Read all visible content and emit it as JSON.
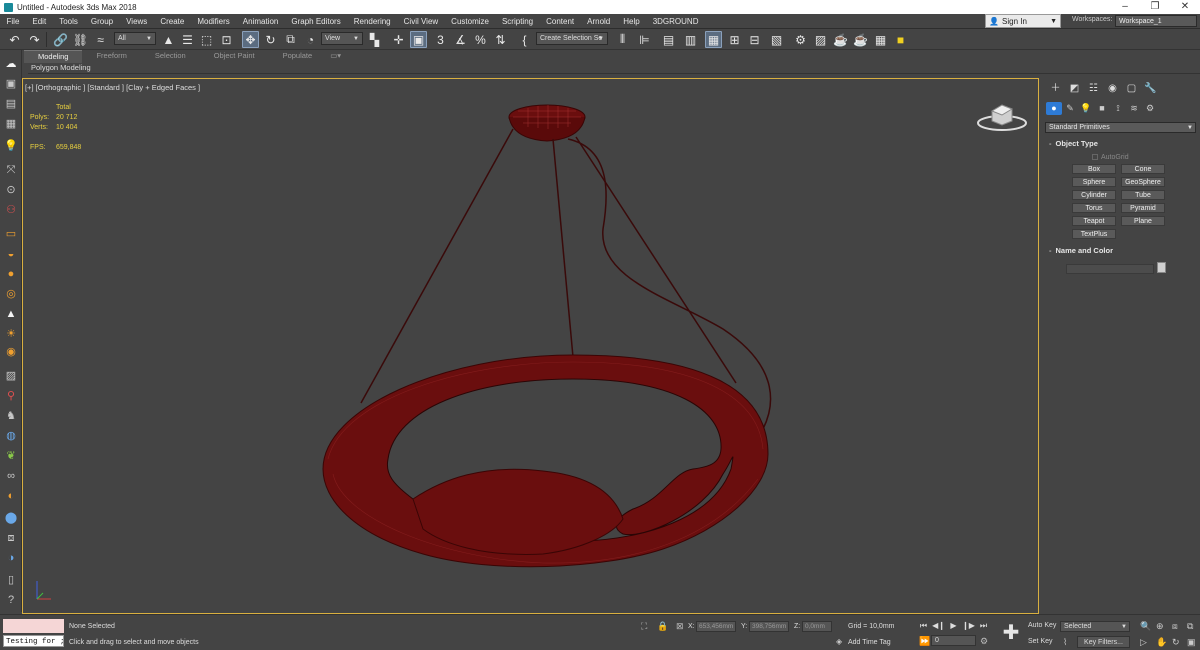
{
  "window": {
    "title": "Untitled - Autodesk 3ds Max 2018",
    "controls": [
      "–",
      "❐",
      "✕"
    ]
  },
  "menu": [
    "File",
    "Edit",
    "Tools",
    "Group",
    "Views",
    "Create",
    "Modifiers",
    "Animation",
    "Graph Editors",
    "Rendering",
    "Civil View",
    "Customize",
    "Scripting",
    "Content",
    "Arnold",
    "Help",
    "3DGROUND"
  ],
  "account": {
    "signin": "Sign In",
    "workspaces_label": "Workspaces:",
    "workspace_value": "Workspace_1"
  },
  "toolbar": {
    "filter_dropdown": "All",
    "reference_dropdown": "View",
    "selection_set_dropdown": "Create Selection Se"
  },
  "ribbon": {
    "tabs": [
      "Modeling",
      "Freeform",
      "Selection",
      "Object Paint",
      "Populate"
    ],
    "active_tab": "Modeling",
    "panel_title": "Polygon Modeling"
  },
  "viewport": {
    "label": "[+] [Orthographic ] [Standard ] [Clay + Edged Faces ]",
    "stats": {
      "header": "Total",
      "polys_label": "Polys:",
      "polys_value": "20 712",
      "verts_label": "Verts:",
      "verts_value": "10 404",
      "fps_label": "FPS:",
      "fps_value": "659,848"
    },
    "border_color": "#d9b040",
    "model_color": "#6a0e0e"
  },
  "command_panel": {
    "category_dropdown": "Standard Primitives",
    "object_type_title": "Object Type",
    "autogrid": "AutoGrid",
    "buttons": [
      "Box",
      "Cone",
      "Sphere",
      "GeoSphere",
      "Cylinder",
      "Tube",
      "Torus",
      "Pyramid",
      "Teapot",
      "Plane",
      "TextPlus"
    ],
    "name_color_title": "Name and Color"
  },
  "status": {
    "maxscript_input": "Testing for ;",
    "selection": "None Selected",
    "prompt": "Click and drag to select and move objects",
    "x_label": "X:",
    "x_value": "653,456mm",
    "y_label": "Y:",
    "y_value": "398,756mm",
    "z_label": "Z:",
    "z_value": "0,0mm",
    "grid": "Grid = 10,0mm",
    "add_time_tag": "Add Time Tag",
    "frame": "0",
    "auto_key": "Auto Key",
    "set_key": "Set Key",
    "selected_dropdown": "Selected",
    "key_filters": "Key Filters..."
  }
}
